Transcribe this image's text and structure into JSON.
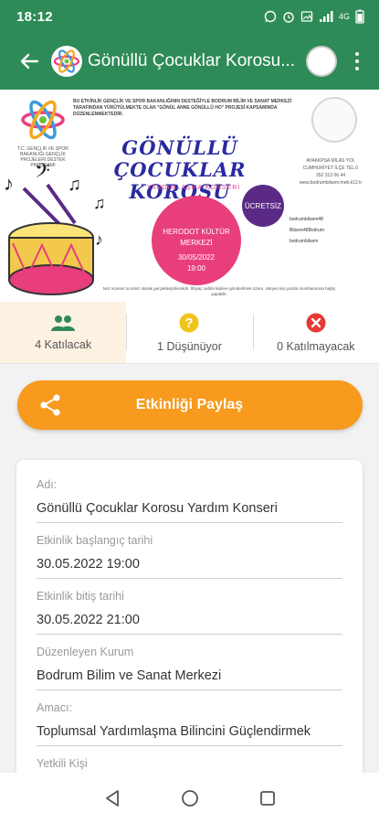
{
  "status_bar": {
    "time": "18:12",
    "signal_text": "4G",
    "battery_text": ""
  },
  "app_bar": {
    "title": "Gönüllü Çocuklar Korosu..."
  },
  "poster": {
    "left_caption": "T.C. GENÇLİK VE SPOR BAKANLIĞI GENÇLİK PROJELERİ DESTEK PROGRAMI",
    "header_text": "BU ETKİNLİK GENÇLİK VE SPOR BAKANLIĞININ DESTEĞİYLE BODRUM BİLİM VE SANAT MERKEZİ TARAFINDAN YÜRÜTÜLMEKTE OLAN \"GÖNÜL ANNE GÖNÜLLÜ HO\" PROJESİ KAPSAMINDA DÜZENLENMEKTEDİR.",
    "title": "GÖNÜLLÜ ÇOCUKLAR KOROSU",
    "subtitle": "YARDIMLAŞMA KONSERİ",
    "venue": "HERODOT KÜLTÜR MERKEZİ",
    "date": "30/05/2022",
    "time": "19:00",
    "badge": "ÜCRETSİZ",
    "address": "AYAKKPSA MİLAS YOL CUMHURİYET İLÇE TEL.0 252 313 06 44 www.bodrumbilsem.meb.k12.tr",
    "social": [
      "bodrumbilsem48",
      "Bilsem48Bodrum",
      "bodrumbilsem"
    ],
    "footer": "Not: Konser ücretsiz olarak gerçekleştirilecektir. İhtiyaç sahibi kişilere gönderilmek üzere, isteyen kişi yardım kumbarasına bağış yapabilir."
  },
  "rsvp": {
    "attending": "4 Katılacak",
    "maybe": "1 Düşünüyor",
    "not_attending": "0 Katılmayacak"
  },
  "share": {
    "label": "Etkinliği Paylaş"
  },
  "details": {
    "name_label": "Adı:",
    "name_value": "Gönüllü Çocuklar Korosu Yardım Konseri",
    "start_label": "Etkinlik başlangıç tarihi",
    "start_value": "30.05.2022 19:00",
    "end_label": "Etkinlik bitiş tarihi",
    "end_value": "30.05.2022 21:00",
    "organizer_label": "Düzenleyen Kurum",
    "organizer_value": "Bodrum Bilim ve Sanat Merkezi",
    "purpose_label": "Amacı:",
    "purpose_value": "Toplumsal Yardımlaşma Bilincini Güçlendirmek",
    "contact_label": "Yetkili Kişi"
  },
  "colors": {
    "primary": "#2e8b57",
    "accent": "#f79a1d",
    "attending": "#2e8b57",
    "maybe": "#f0c419",
    "not_attending": "#e53935"
  }
}
